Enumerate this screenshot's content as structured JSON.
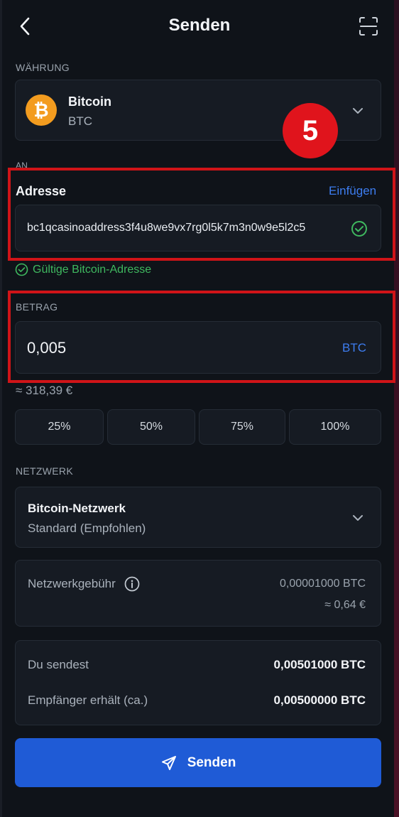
{
  "header": {
    "title": "Senden"
  },
  "currency": {
    "section_label": "WÄHRUNG",
    "coin_symbol": "₿",
    "name": "Bitcoin",
    "ticker": "BTC"
  },
  "recipient": {
    "section_label": "AN",
    "address_label": "Adresse",
    "paste_label": "Einfügen",
    "address_value": "bc1qcasinoaddress3f4u8we9vx7rg0l5k7m3n0w9e5l2c5",
    "valid_text": "Gültige Bitcoin-Adresse"
  },
  "step_badge": "5",
  "amount": {
    "section_label": "BETRAG",
    "value": "0,005",
    "unit": "BTC",
    "fiat_equivalent": "≈ 318,39 €",
    "quick_buttons": [
      "25%",
      "50%",
      "75%",
      "100%"
    ]
  },
  "network": {
    "section_label": "NETZWERK",
    "name": "Bitcoin-Netzwerk",
    "speed": "Standard (Empfohlen)"
  },
  "fee": {
    "label": "Netzwerkgebühr",
    "btc": "0,00001000 BTC",
    "fiat": "≈ 0,64 €"
  },
  "summary": {
    "you_send_label": "Du sendest",
    "you_send_value": "0,00501000 BTC",
    "receiver_label": "Empfänger erhält (ca.)",
    "receiver_value": "0,00500000 BTC"
  },
  "send_button": {
    "label": "Senden"
  },
  "colors": {
    "accent_blue": "#1f5bd6",
    "link_blue": "#3d7df0",
    "valid_green": "#3fb85f",
    "highlight_red": "#d01418",
    "bitcoin_orange": "#f39c1f"
  }
}
